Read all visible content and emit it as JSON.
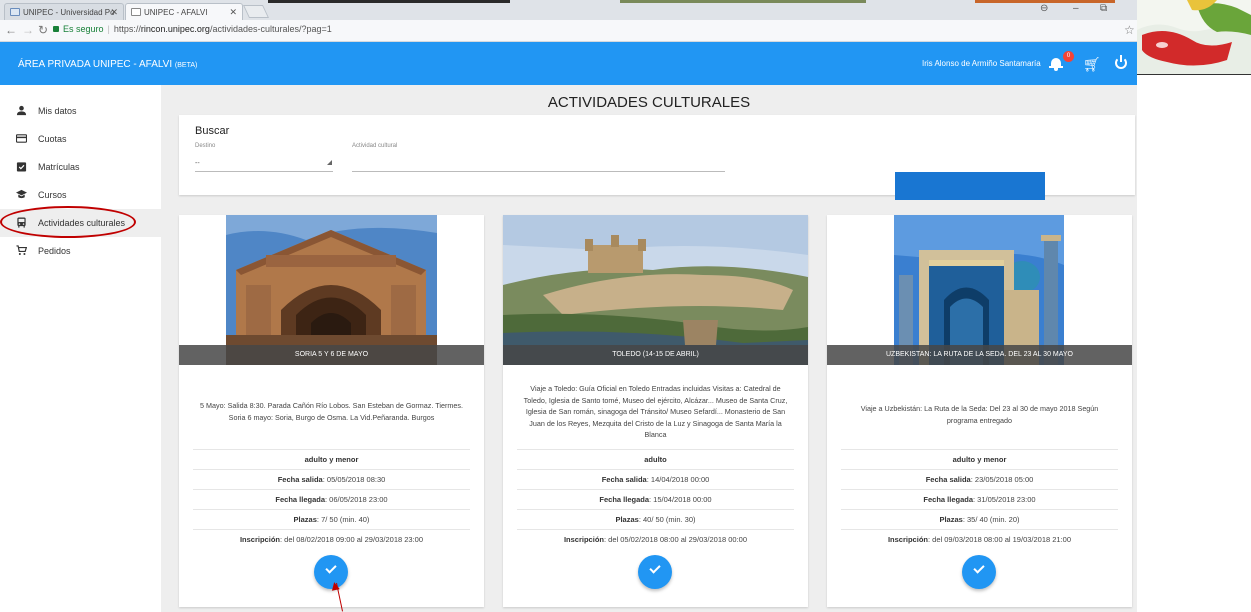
{
  "browser": {
    "tabs": [
      {
        "title": "UNIPEC - Universidad Po"
      },
      {
        "title": "UNIPEC - AFALVI"
      }
    ],
    "secure_label": "Es seguro",
    "url_protocol": "https://",
    "url_domain": "rincon.unipec.org",
    "url_path": "/actividades-culturales/?pag=1"
  },
  "appbar": {
    "title": "ÁREA PRIVADA UNIPEC - AFALVI",
    "beta": "(BETA)",
    "username": "Iris Alonso de Armiño Santamaría",
    "notification_count": "0",
    "color": "#2196f3"
  },
  "sidebar": {
    "items": [
      {
        "label": "Mis datos",
        "icon": "person-icon"
      },
      {
        "label": "Cuotas",
        "icon": "credit-card-icon"
      },
      {
        "label": "Matrículas",
        "icon": "assignment-icon"
      },
      {
        "label": "Cursos",
        "icon": "school-icon"
      },
      {
        "label": "Actividades culturales",
        "icon": "bus-icon",
        "active": true
      },
      {
        "label": "Pedidos",
        "icon": "cart-icon"
      }
    ]
  },
  "main": {
    "title": "ACTIVIDADES CULTURALES",
    "search": {
      "heading": "Buscar",
      "destino_label": "Destino",
      "destino_value": "--",
      "actividad_label": "Actividad cultural"
    },
    "cards": [
      {
        "caption": "SORIA 5 Y 6 DE MAYO",
        "description": "5 Mayo: Salida 8:30. Parada Cañón Río Lobos. San Esteban de Gormaz. Tiermes. Soria 6 mayo: Soria, Burgo de Osma. La Vid.Peñaranda. Burgos",
        "audience": "adulto y menor",
        "fecha_salida_label": "Fecha salida",
        "fecha_salida": ": 05/05/2018 08:30",
        "fecha_llegada_label": "Fecha llegada",
        "fecha_llegada": ": 06/05/2018 23:00",
        "plazas_label": "Plazas",
        "plazas": ": 7/ 50 (min. 40)",
        "inscripcion_label": "Inscripción",
        "inscripcion": ": del 08/02/2018 09:00 al 29/03/2018 23:00"
      },
      {
        "caption": "TOLEDO (14-15 DE ABRIL)",
        "description": "Viaje a Toledo: Guía Oficial en Toledo Entradas incluidas Visitas a: Catedral de Toledo, Iglesia de Santo tomé, Museo del ejército, Alcázar... Museo de Santa Cruz, Iglesia de San román, sinagoga del Tránsito/ Museo Sefardí... Monasterio de San Juan de los Reyes, Mezquita del Cristo de la Luz y Sinagoga de Santa María la Blanca",
        "audience": "adulto",
        "fecha_salida_label": "Fecha salida",
        "fecha_salida": ": 14/04/2018 00:00",
        "fecha_llegada_label": "Fecha llegada",
        "fecha_llegada": ": 15/04/2018 00:00",
        "plazas_label": "Plazas",
        "plazas": ": 40/ 50 (min. 30)",
        "inscripcion_label": "Inscripción",
        "inscripcion": ": del 05/02/2018 08:00 al 29/03/2018 00:00"
      },
      {
        "caption": "UZBEKISTAN: LA RUTA DE LA SEDA. DEL 23 AL 30 MAYO",
        "description": "Viaje a Uzbekistán: La Ruta de la Seda: Del 23 al 30 de mayo 2018 Según programa entregado",
        "audience": "adulto y menor",
        "fecha_salida_label": "Fecha salida",
        "fecha_salida": ": 23/05/2018 05:00",
        "fecha_llegada_label": "Fecha llegada",
        "fecha_llegada": ": 31/05/2018 23:00",
        "plazas_label": "Plazas",
        "plazas": ": 35/ 40 (min. 20)",
        "inscripcion_label": "Inscripción",
        "inscripcion": ": del 09/03/2018 08:00 al 19/03/2018 21:00"
      }
    ]
  }
}
